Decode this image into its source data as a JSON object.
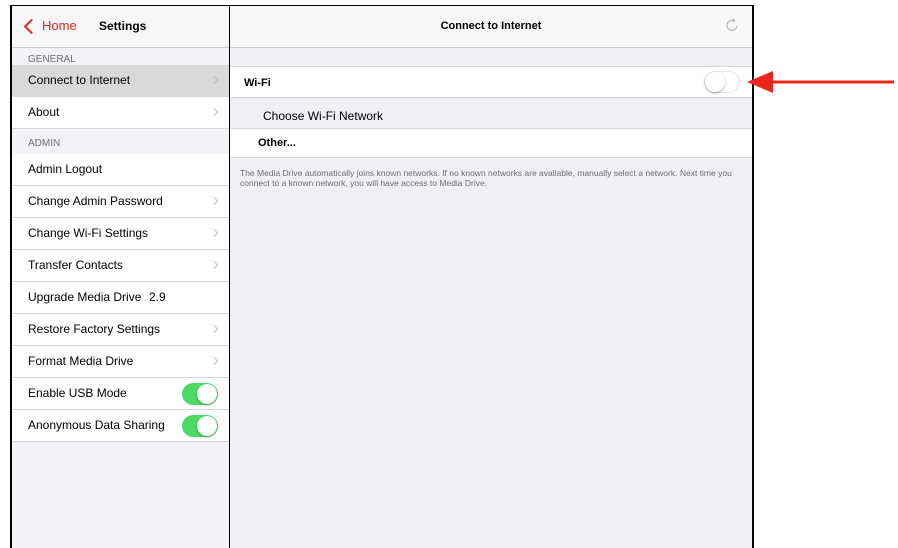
{
  "sidebar": {
    "back_label": "Home",
    "title": "Settings",
    "section_general": "GENERAL",
    "section_admin": "ADMIN",
    "items": [
      {
        "label": "Connect to Internet"
      },
      {
        "label": "About"
      },
      {
        "label": "Admin Logout"
      },
      {
        "label": "Change Admin Password"
      },
      {
        "label": "Change Wi-Fi Settings"
      },
      {
        "label": "Transfer Contacts"
      },
      {
        "label": "Upgrade Media Drive",
        "value": "2.9"
      },
      {
        "label": "Restore Factory Settings"
      },
      {
        "label": "Format Media Drive"
      },
      {
        "label": "Enable USB Mode",
        "toggle": "on"
      },
      {
        "label": "Anonymous Data Sharing",
        "toggle": "on"
      }
    ]
  },
  "main": {
    "title": "Connect to Internet",
    "wifi_label": "Wi-Fi",
    "wifi_toggle": "off",
    "choose_network_label": "Choose Wi-Fi Network",
    "other_label": "Other...",
    "note": "The Media Drive automatically joins known networks. If no known networks are available, manually select a network. Next time you connect to a known network, you will have access to Media Drive."
  },
  "colors": {
    "accent": "#e0251b",
    "toggle_on": "#4cd964",
    "annotation_arrow": "#e8261c"
  }
}
